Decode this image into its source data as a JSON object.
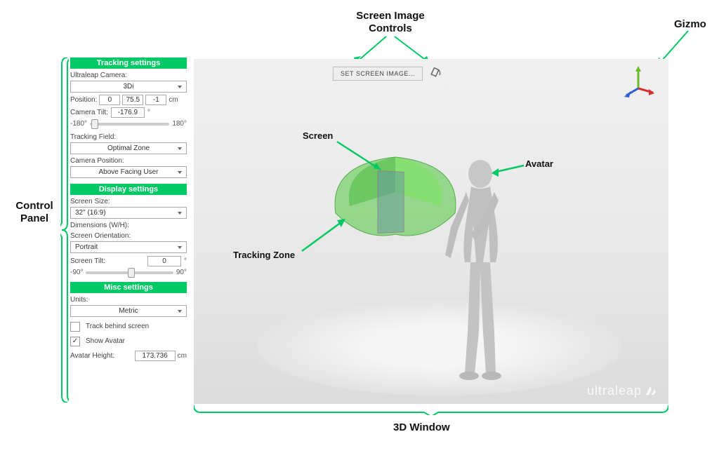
{
  "annotations": {
    "control_panel": "Control\nPanel",
    "screen_image_controls": "Screen Image\nControls",
    "gizmo": "Gizmo",
    "screen": "Screen",
    "avatar": "Avatar",
    "tracking_zone": "Tracking Zone",
    "window3d": "3D Window"
  },
  "panel": {
    "tracking": {
      "header": "Tracking settings",
      "camera_label": "Ultraleap Camera:",
      "camera_value": "3Di",
      "position_label": "Position:",
      "pos_x": "0",
      "pos_y": "75.5",
      "pos_z": "-1",
      "pos_unit": "cm",
      "tilt_label": "Camera Tilt:",
      "tilt_value": "-176.9",
      "tilt_unit": "°",
      "slider_min": "-180°",
      "slider_max": "180°",
      "field_label": "Tracking Field:",
      "field_value": "Optimal Zone",
      "camera_pos_label": "Camera Position:",
      "camera_pos_value": "Above Facing User"
    },
    "display": {
      "header": "Display settings",
      "size_label": "Screen Size:",
      "size_value": "32\" (16:9)",
      "dims_label": "Dimensions (W/H):",
      "orientation_label": "Screen Orientation:",
      "orientation_value": "Portrait",
      "tilt_label": "Screen Tilt:",
      "tilt_value": "0",
      "tilt_unit": "°",
      "slider_min": "-90°",
      "slider_max": "90°"
    },
    "misc": {
      "header": "Misc settings",
      "units_label": "Units:",
      "units_value": "Metric",
      "track_behind": "Track behind screen",
      "track_behind_checked": false,
      "show_avatar": "Show Avatar",
      "show_avatar_checked": true,
      "height_label": "Avatar Height:",
      "height_value": "173.736",
      "height_unit": "cm"
    }
  },
  "viewport": {
    "screen_button": "SET SCREEN IMAGE...",
    "brand": "ultraleap"
  },
  "colors": {
    "accent": "#00c864"
  }
}
